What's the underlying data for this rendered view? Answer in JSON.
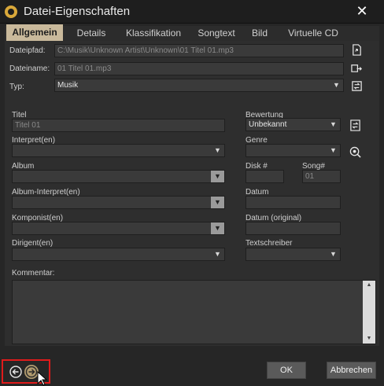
{
  "window": {
    "title": "Datei-Eigenschaften",
    "close_glyph": "✕"
  },
  "tabs": [
    {
      "label": "Allgemein",
      "active": true
    },
    {
      "label": "Details"
    },
    {
      "label": "Klassifikation"
    },
    {
      "label": "Songtext"
    },
    {
      "label": "Bild"
    },
    {
      "label": "Virtuelle CD"
    }
  ],
  "file": {
    "path_label": "Dateipfad:",
    "path_value": "C:\\Musik\\Unknown Artist\\Unknown\\01 Titel 01.mp3",
    "name_label": "Dateiname:",
    "name_value": "01 Titel 01.mp3",
    "type_label": "Typ:",
    "type_value": "Musik"
  },
  "fields": {
    "title_label": "Titel",
    "title_value": "Titel 01",
    "artist_label": "Interpret(en)",
    "album_label": "Album",
    "album_artist_label": "Album-Interpret(en)",
    "composer_label": "Komponist(en)",
    "conductor_label": "Dirigent(en)",
    "rating_label": "Bewertung",
    "rating_value": "Unbekannt",
    "genre_label": "Genre",
    "disk_label": "Disk #",
    "song_label": "Song#",
    "song_value": "01",
    "date_label": "Datum",
    "date_orig_label": "Datum (original)",
    "lyricist_label": "Textschreiber",
    "comment_label": "Kommentar:"
  },
  "buttons": {
    "ok": "OK",
    "cancel": "Abbrechen"
  },
  "colors": {
    "highlight": "#e01b1b",
    "tab_active": "#c9b99b",
    "nav_next": "#b09a6e"
  }
}
